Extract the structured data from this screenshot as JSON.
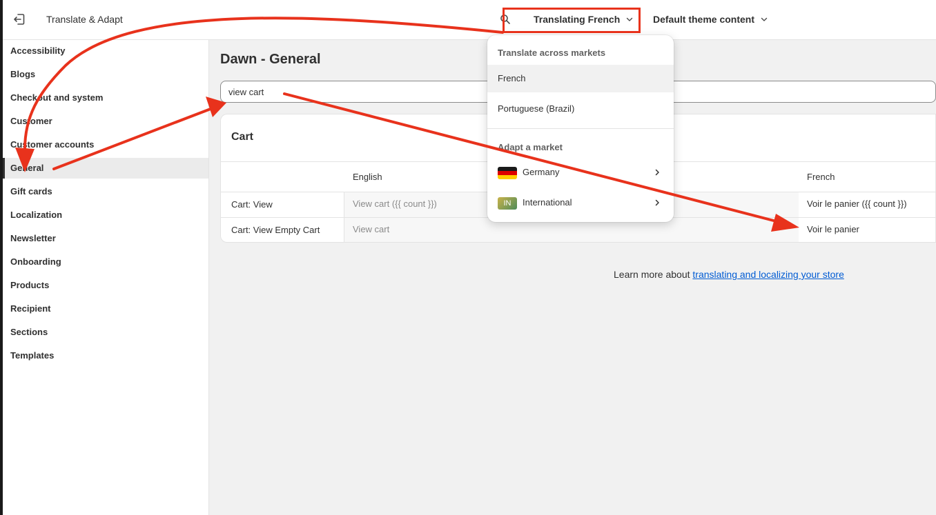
{
  "topbar": {
    "app_title": "Translate & Adapt",
    "locale_label": "Translating French",
    "theme_label": "Default theme content",
    "icons": [
      "exit-icon",
      "search-icon",
      "chevron-down-icon"
    ]
  },
  "sidebar": {
    "items": [
      {
        "label": "Accessibility",
        "active": false
      },
      {
        "label": "Blogs",
        "active": false
      },
      {
        "label": "Checkout and system",
        "active": false
      },
      {
        "label": "Customer",
        "active": false
      },
      {
        "label": "Customer accounts",
        "active": false
      },
      {
        "label": "General",
        "active": true
      },
      {
        "label": "Gift cards",
        "active": false
      },
      {
        "label": "Localization",
        "active": false
      },
      {
        "label": "Newsletter",
        "active": false
      },
      {
        "label": "Onboarding",
        "active": false
      },
      {
        "label": "Products",
        "active": false
      },
      {
        "label": "Recipient",
        "active": false
      },
      {
        "label": "Sections",
        "active": false
      },
      {
        "label": "Templates",
        "active": false
      }
    ]
  },
  "main": {
    "page_title": "Dawn - General",
    "search_value": "view cart",
    "card": {
      "title": "Cart",
      "columns": {
        "source": "English",
        "target": "French"
      },
      "rows": [
        {
          "key": "Cart: View",
          "source": "View cart ({{ count }})",
          "target": "Voir le panier ({{ count }})"
        },
        {
          "key": "Cart: View Empty Cart",
          "source": "View cart",
          "target": "Voir le panier"
        }
      ]
    },
    "learn_more": {
      "prefix": "Learn more about ",
      "link": "translating and localizing your store"
    }
  },
  "popover": {
    "translate_heading": "Translate across markets",
    "languages": [
      {
        "label": "French",
        "selected": true
      },
      {
        "label": "Portuguese (Brazil)",
        "selected": false
      }
    ],
    "adapt_heading": "Adapt a market",
    "markets": [
      {
        "label": "Germany",
        "icon": "germany-flag-icon"
      },
      {
        "label": "International",
        "badge": "IN",
        "icon": "international-badge-icon"
      }
    ]
  },
  "colors": {
    "annotation_red": "#e8321c",
    "link_blue": "#005bd3",
    "page_bg": "#f1f1f1"
  }
}
